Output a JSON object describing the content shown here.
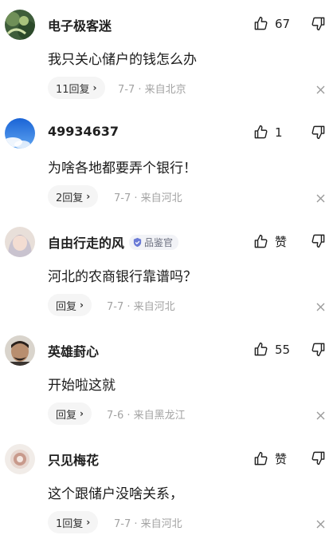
{
  "comments": [
    {
      "username": "电子极客迷",
      "likes": "67",
      "content": "我只关心储户的钱怎么办",
      "reply_label": "11回复",
      "meta": "7-7 · 来自北京"
    },
    {
      "username": "49934637",
      "likes": "1",
      "content": "为啥各地都要弄个银行！",
      "reply_label": "2回复",
      "meta": "7-7 · 来自河北"
    },
    {
      "username": "自由行走的风",
      "badge": "品鉴官",
      "likes": "赞",
      "content": "河北的农商银行靠谱吗？",
      "reply_label": "回复",
      "meta": "7-7 · 来自河北"
    },
    {
      "username": "英雄葑心",
      "likes": "55",
      "content": "开始啦这就",
      "reply_label": "回复",
      "meta": "7-6 · 来自黑龙江"
    },
    {
      "username": "只见梅花",
      "likes": "赞",
      "content": "这个跟储户没啥关系，",
      "reply_label": "1回复",
      "meta": "7-7 · 来自河北"
    }
  ],
  "icons": {
    "like": "thumbs-up-icon",
    "dislike": "thumbs-down-icon",
    "close": "close-icon",
    "badge": "verified-badge-icon",
    "reply_chevron": "chevron-right-icon"
  },
  "colors": {
    "meta_text": "#a3a3a3",
    "pill_bg": "#f5f5f5",
    "badge_icon": "#6b7bd6"
  }
}
